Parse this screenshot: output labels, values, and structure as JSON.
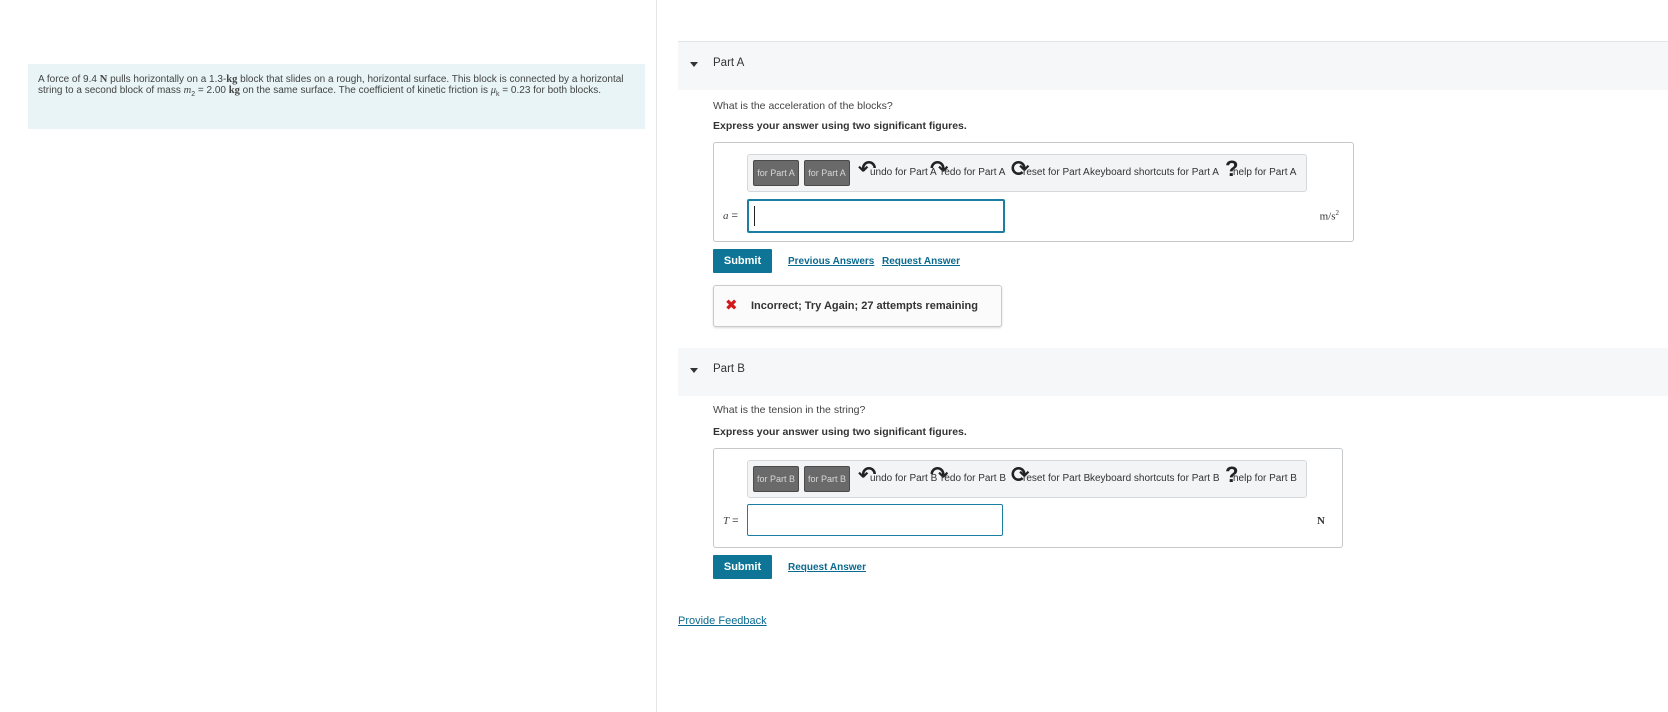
{
  "problem": {
    "pre_force": "A force of 9.4 ",
    "force_unit": "N",
    "mid1": " pulls horizontally on a 1.3-",
    "mass_unit": "kg",
    "mid2": " block that slides on a rough, horizontal surface. This block is connected by a horizontal string to a second block of mass ",
    "m2_symbol": "m",
    "m2_sub": "2",
    "mid3": " = 2.00 ",
    "mass_unit2": "kg",
    "mid4": " on the same surface. The coefficient of kinetic friction is ",
    "mu_symbol": "μ",
    "mu_sub": "k",
    "mid5": " = 0.23 for both blocks."
  },
  "partA": {
    "title": "Part A",
    "question": "What is the acceleration of the blocks?",
    "instruction": "Express your answer using two significant figures.",
    "toolbar": {
      "btn1": "for Part A",
      "btn2": "for Part A",
      "undo": "undo for Part A",
      "redo": "redo for Part A",
      "reset": "reset for Part A",
      "keyboard": "keyboard shortcuts for Part A",
      "help": "help for Part A"
    },
    "variable": "a",
    "equals": " =",
    "unit_base": "m/s",
    "unit_exp": "2",
    "submit": "Submit",
    "previous_answers": "Previous Answers",
    "request_answer": "Request Answer",
    "feedback": "Incorrect; Try Again; 27 attempts remaining"
  },
  "partB": {
    "title": "Part B",
    "question": "What is the tension in the string?",
    "instruction": "Express your answer using two significant figures.",
    "toolbar": {
      "btn1": "for Part B",
      "btn2": "for Part B",
      "undo": "undo for Part B",
      "redo": "redo for Part B",
      "reset": "reset for Part B",
      "keyboard": "keyboard shortcuts for Part B",
      "help": "help for Part B"
    },
    "variable": "T",
    "equals": " =",
    "unit": "N",
    "submit": "Submit",
    "request_answer": "Request Answer"
  },
  "provide_feedback": "Provide Feedback",
  "colors": {
    "problem_bg": "#e8f4f5",
    "submit_bg": "#0f7596",
    "link": "#0b6a8f",
    "error": "#d4191d",
    "input_border": "#1a7fa3"
  }
}
